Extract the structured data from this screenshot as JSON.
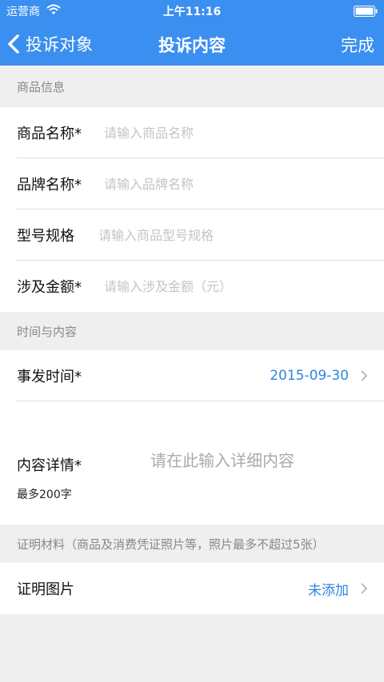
{
  "status_bar": {
    "carrier": "运营商",
    "time": "上午11:16"
  },
  "nav": {
    "back_label": "投诉对象",
    "title": "投诉内容",
    "done_label": "完成"
  },
  "product_section": {
    "title": "商品信息",
    "fields": [
      {
        "label": "商品名称*",
        "placeholder": "请输入商品名称"
      },
      {
        "label": "品牌名称*",
        "placeholder": "请输入品牌名称"
      },
      {
        "label": "型号规格",
        "placeholder": "请输入商品型号规格"
      },
      {
        "label": "涉及金额*",
        "placeholder": "请输入涉及金额（元）"
      }
    ]
  },
  "time_section": {
    "title": "时间与内容",
    "event_time": {
      "label": "事发时间*",
      "value": "2015-09-30"
    },
    "detail": {
      "label": "内容详情*",
      "hint": "最多200字",
      "placeholder": "请在此输入详细内容"
    }
  },
  "evidence_section": {
    "title": "证明材料（商品及消费凭证照片等，照片最多不超过5张）",
    "photos": {
      "label": "证明图片",
      "value": "未添加"
    }
  },
  "colors": {
    "accent": "#3a8ff0",
    "link": "#2f86e0",
    "background": "#efefef"
  }
}
